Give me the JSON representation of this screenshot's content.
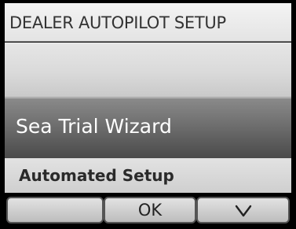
{
  "title_bar": {
    "title": "DEALER AUTOPILOT SETUP"
  },
  "menu": {
    "items": [
      {
        "label": ""
      },
      {
        "label": "Sea Trial Wizard",
        "selected": true
      },
      {
        "label": "Automated Setup"
      }
    ]
  },
  "softkeys": {
    "left_label": "",
    "middle_label": "OK",
    "right_icon": "chevron-down-icon"
  },
  "colors": {
    "selected_item": "#6b6b6b",
    "menu_background": "#d4d4d4",
    "bezel": "#000000"
  }
}
